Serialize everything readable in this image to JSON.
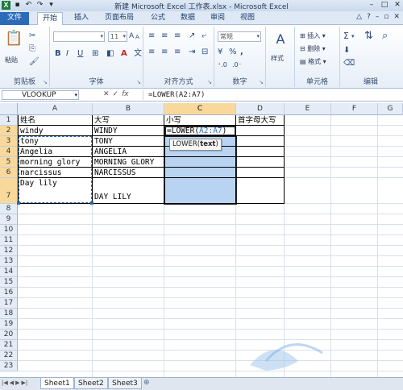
{
  "title_bar": {
    "title": "新建 Microsoft Excel 工作表.xlsx - Microsoft Excel",
    "window_controls": [
      "–",
      "□",
      "✕"
    ]
  },
  "ribbon_tabs": [
    "文件",
    "开始",
    "插入",
    "页面布局",
    "公式",
    "数据",
    "审阅",
    "视图"
  ],
  "ribbon_groups": {
    "clipboard": {
      "label": "剪贴板",
      "paste": "粘贴"
    },
    "font": {
      "label": "字体",
      "size": "11",
      "bold": "B",
      "italic": "I",
      "underline": "U",
      "grow": "A",
      "shrink": "A"
    },
    "alignment": {
      "label": "对齐方式"
    },
    "number": {
      "label": "数字",
      "format": "常规",
      "percent": "%",
      "comma": ","
    },
    "styles": {
      "label": "",
      "styles": "样式"
    },
    "cells": {
      "label": "单元格",
      "insert": "插入",
      "delete": "删除",
      "format": "格式"
    },
    "editing": {
      "label": "编辑",
      "sum": "Σ"
    }
  },
  "formula_bar": {
    "name_box": "VLOOKUP",
    "cancel": "✕",
    "enter": "✓",
    "fx": "fx",
    "formula": "=LOWER(A2:A7)"
  },
  "columns": [
    "A",
    "B",
    "C",
    "D",
    "E",
    "F",
    "G"
  ],
  "rows": [
    "1",
    "2",
    "3",
    "4",
    "5",
    "6",
    "7",
    "8",
    "9",
    "10",
    "11",
    "12",
    "13",
    "14",
    "15",
    "16",
    "17",
    "18",
    "19",
    "20",
    "21",
    "22",
    "23"
  ],
  "cells": {
    "A1": "姓名",
    "B1": "大写",
    "C1": "小写",
    "D1": "首字母大写",
    "A2": "windy",
    "B2": "WINDY",
    "A3": "tony",
    "B3": "TONY",
    "A4": "Angelia",
    "B4": "ANGELIA",
    "A5": "morning glory",
    "B5": "MORNING GLORY",
    "A6": "narcissus",
    "B6": "NARCISSUS",
    "A7": "Day lily",
    "B7": "DAY LILY"
  },
  "edit_cell": {
    "prefix": "=LOWER(",
    "ref": "A2:A7",
    "suffix": ")"
  },
  "tooltip": {
    "fn": "LOWER(",
    "arg": "text",
    "close": ")"
  },
  "sheet_tabs": [
    "Sheet1",
    "Sheet2",
    "Sheet3"
  ],
  "colors": {
    "selected_header": "#f9d99b",
    "range_fill": "#b9d4f2",
    "file_tab": "#2b6bb7"
  }
}
